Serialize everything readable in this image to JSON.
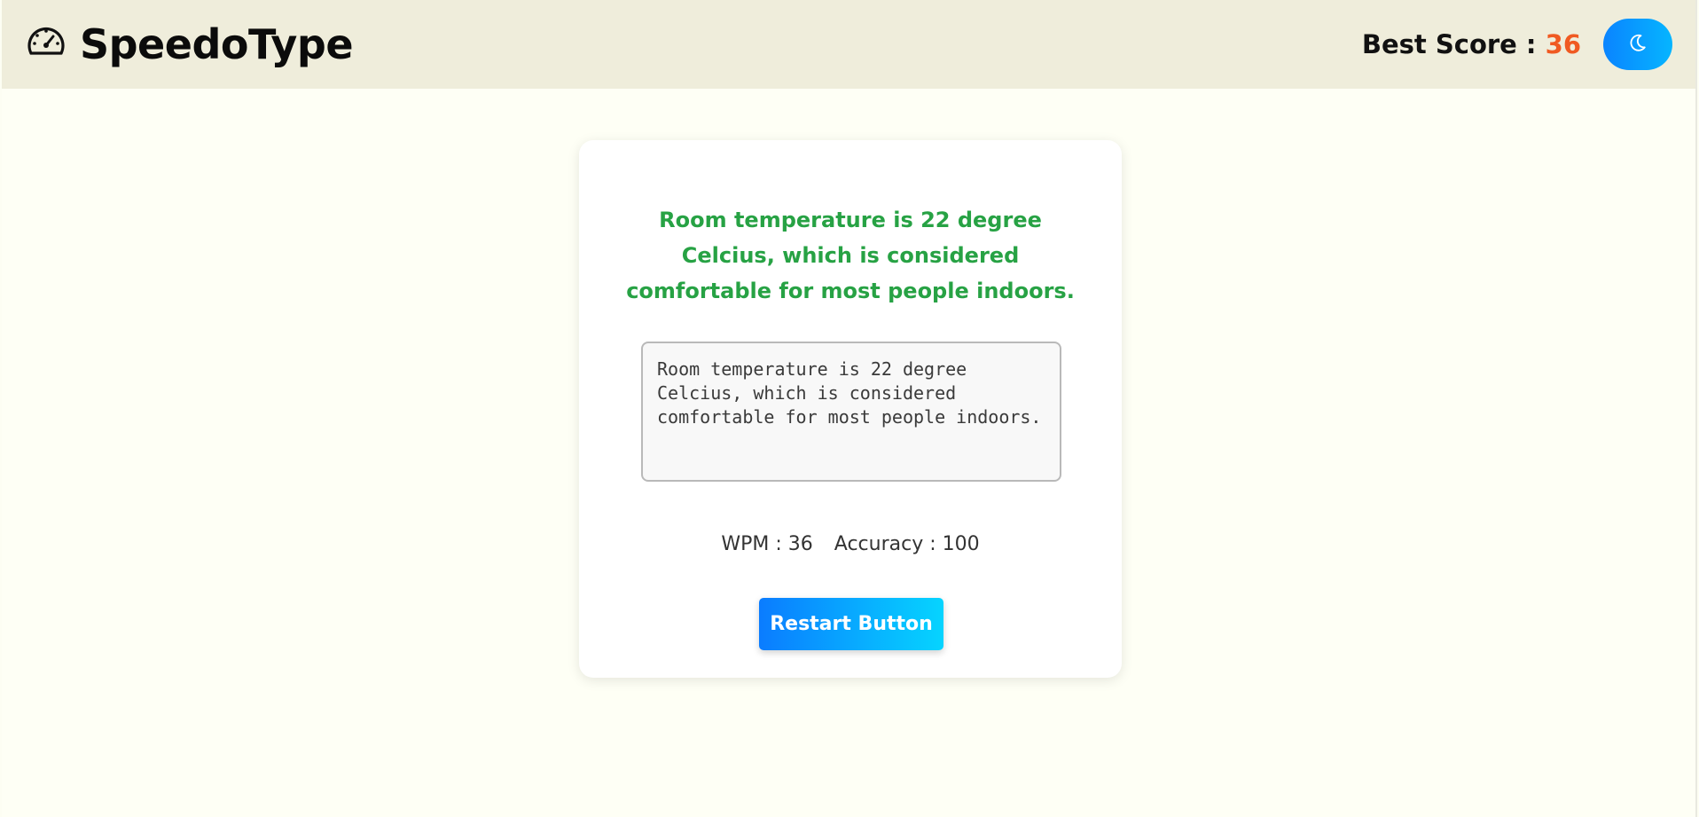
{
  "header": {
    "app_title": "SpeedoType",
    "logo_icon": "speedometer-icon",
    "best_score_label": "Best Score : ",
    "best_score_value": "36",
    "theme_toggle_icon": "moon-icon"
  },
  "main": {
    "prompt_text": "Room temperature is 22 degree Celcius, which is considered comfortable for most people indoors.",
    "typed_text": "Room temperature is 22 degree Celcius, which is considered comfortable for most people indoors.",
    "wpm_label": "WPM : 36",
    "accuracy_label": "Accuracy : 100",
    "restart_label": "Restart Button"
  },
  "colors": {
    "header_bg": "#efeddb",
    "page_bg": "#fefff5",
    "prompt_correct": "#27a244",
    "best_score_value": "#f05a22",
    "accent_blue": "#0a84ff"
  }
}
